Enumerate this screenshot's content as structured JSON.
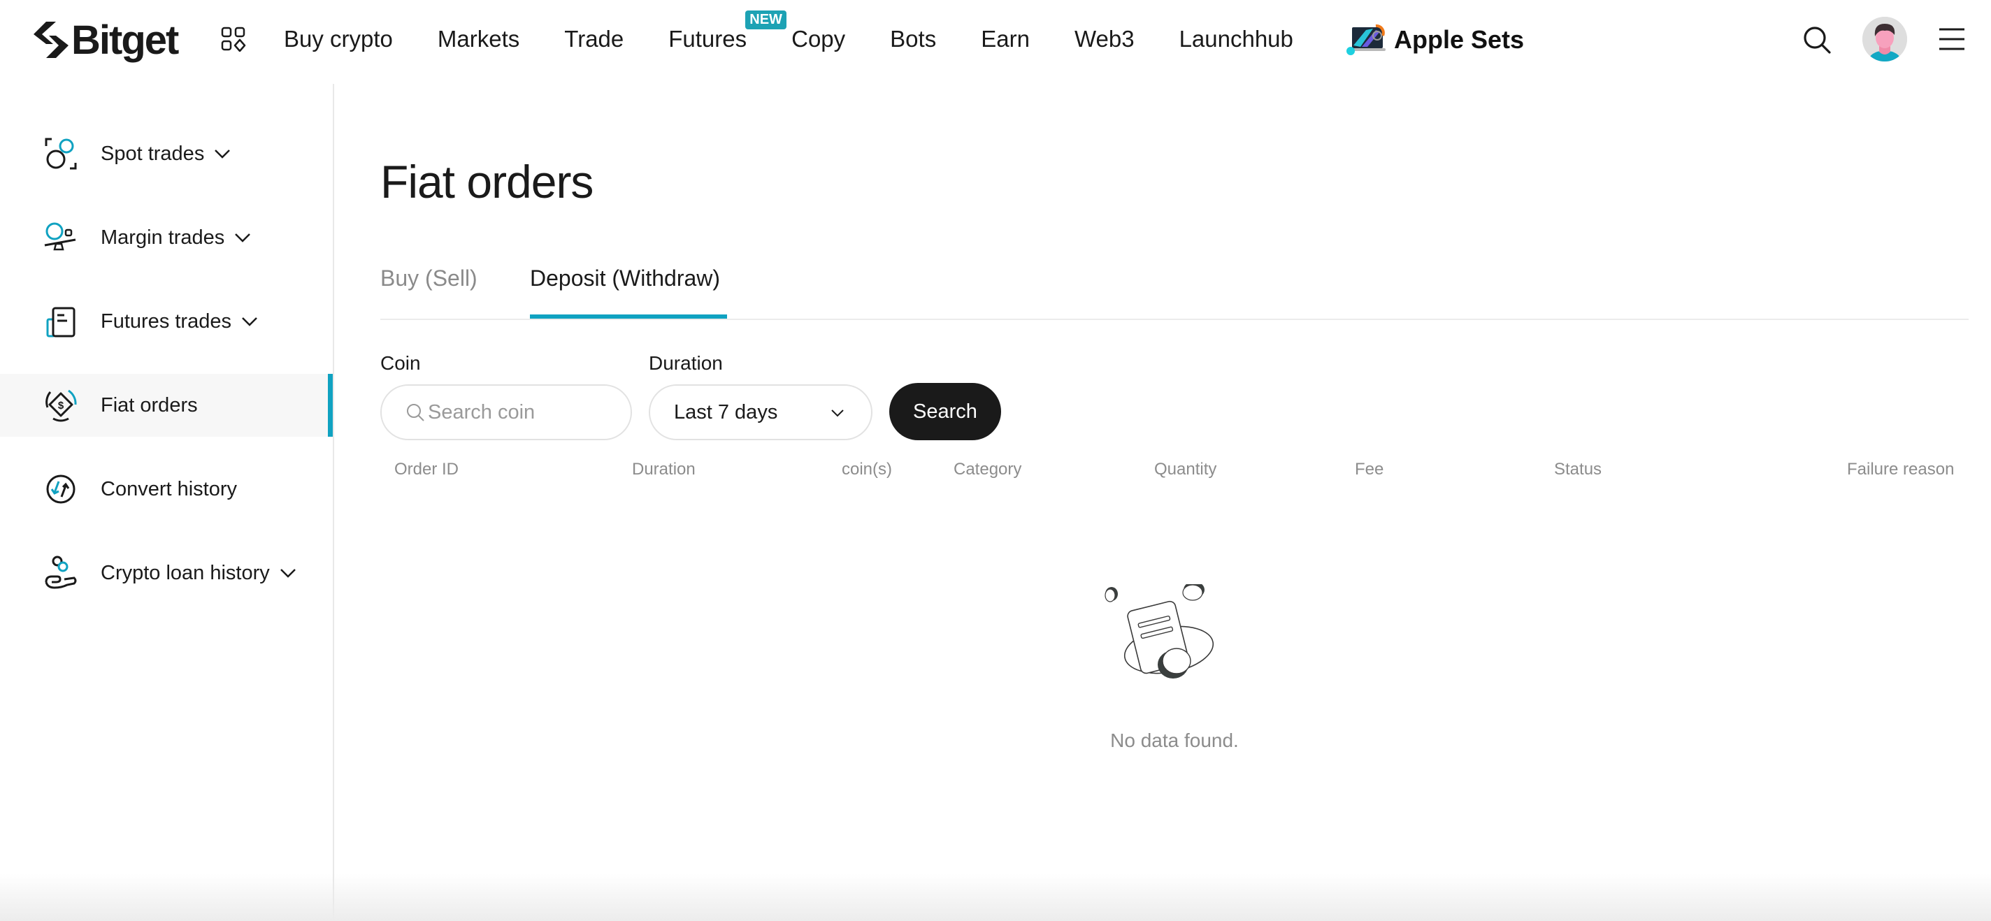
{
  "header": {
    "logo_text": "Bitget",
    "nav": [
      {
        "label": "Buy crypto"
      },
      {
        "label": "Markets"
      },
      {
        "label": "Trade"
      },
      {
        "label": "Futures",
        "badge": "NEW"
      },
      {
        "label": "Copy"
      },
      {
        "label": "Bots"
      },
      {
        "label": "Earn"
      },
      {
        "label": "Web3"
      },
      {
        "label": "Launchhub"
      }
    ],
    "promo_label": "Apple Sets",
    "icons": {
      "apps": "apps-grid-icon",
      "search": "search-icon",
      "avatar": "user-avatar",
      "menu": "hamburger-menu-icon"
    }
  },
  "sidebar": {
    "items": [
      {
        "label": "Spot trades",
        "icon": "spot-trades-icon",
        "has_submenu": true
      },
      {
        "label": "Margin trades",
        "icon": "margin-trades-icon",
        "has_submenu": true
      },
      {
        "label": "Futures trades",
        "icon": "futures-trades-icon",
        "has_submenu": true
      },
      {
        "label": "Fiat orders",
        "icon": "fiat-orders-icon",
        "has_submenu": false,
        "active": true
      },
      {
        "label": "Convert history",
        "icon": "convert-history-icon",
        "has_submenu": false
      },
      {
        "label": "Crypto loan history",
        "icon": "crypto-loan-icon",
        "has_submenu": true
      }
    ]
  },
  "main": {
    "title": "Fiat orders",
    "tabs": [
      {
        "label": "Buy (Sell)",
        "active": false
      },
      {
        "label": "Deposit (Withdraw)",
        "active": true
      }
    ],
    "filters": {
      "coin_label": "Coin",
      "coin_placeholder": "Search coin",
      "coin_value": "",
      "duration_label": "Duration",
      "duration_value": "Last 7 days",
      "search_button": "Search"
    },
    "table": {
      "columns": [
        "Order ID",
        "Duration",
        "coin(s)",
        "Category",
        "Quantity",
        "Fee",
        "Status",
        "Failure reason"
      ],
      "rows": []
    },
    "empty_text": "No data found."
  },
  "colors": {
    "accent": "#10a2c1",
    "badge": "#1da2b4",
    "primary_button": "#1a1a1a",
    "muted_text": "#8c8c8c"
  }
}
